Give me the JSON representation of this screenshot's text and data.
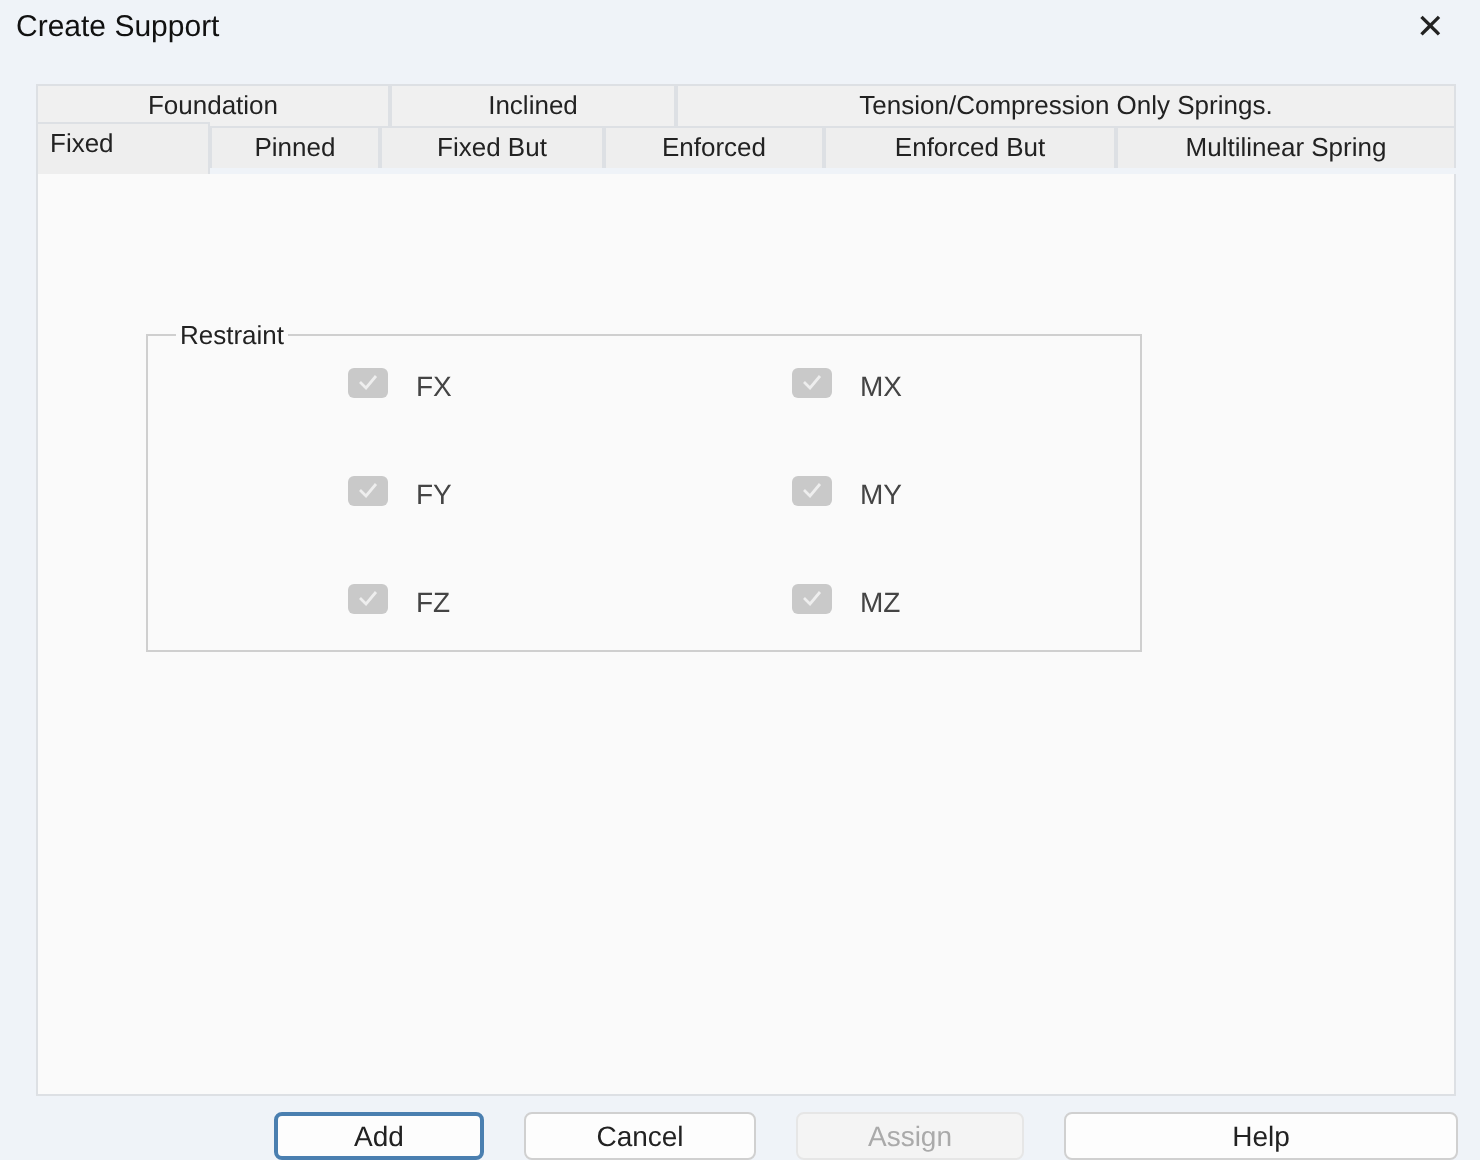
{
  "window": {
    "title": "Create Support",
    "close": "✕"
  },
  "tab_rows": [
    [
      {
        "label": "Foundation",
        "selected": false
      },
      {
        "label": "Inclined",
        "selected": false
      },
      {
        "label": "Tension/Compression Only Springs.",
        "selected": false
      }
    ],
    [
      {
        "label": "Fixed",
        "selected": true
      },
      {
        "label": "Pinned",
        "selected": false
      },
      {
        "label": "Fixed But",
        "selected": false
      },
      {
        "label": "Enforced",
        "selected": false
      },
      {
        "label": "Enforced But",
        "selected": false
      },
      {
        "label": "Multilinear Spring",
        "selected": false
      }
    ]
  ],
  "restraint": {
    "title": "Restraint",
    "checkboxes": [
      {
        "label": "FX",
        "checked": true,
        "disabled": true
      },
      {
        "label": "MX",
        "checked": true,
        "disabled": true
      },
      {
        "label": "FY",
        "checked": true,
        "disabled": true
      },
      {
        "label": "MY",
        "checked": true,
        "disabled": true
      },
      {
        "label": "FZ",
        "checked": true,
        "disabled": true
      },
      {
        "label": "MZ",
        "checked": true,
        "disabled": true
      }
    ]
  },
  "buttons": [
    {
      "label": "Add",
      "focused": true,
      "disabled": false
    },
    {
      "label": "Cancel",
      "focused": false,
      "disabled": false
    },
    {
      "label": "Assign",
      "focused": false,
      "disabled": true
    },
    {
      "label": "Help",
      "focused": false,
      "disabled": false
    }
  ]
}
